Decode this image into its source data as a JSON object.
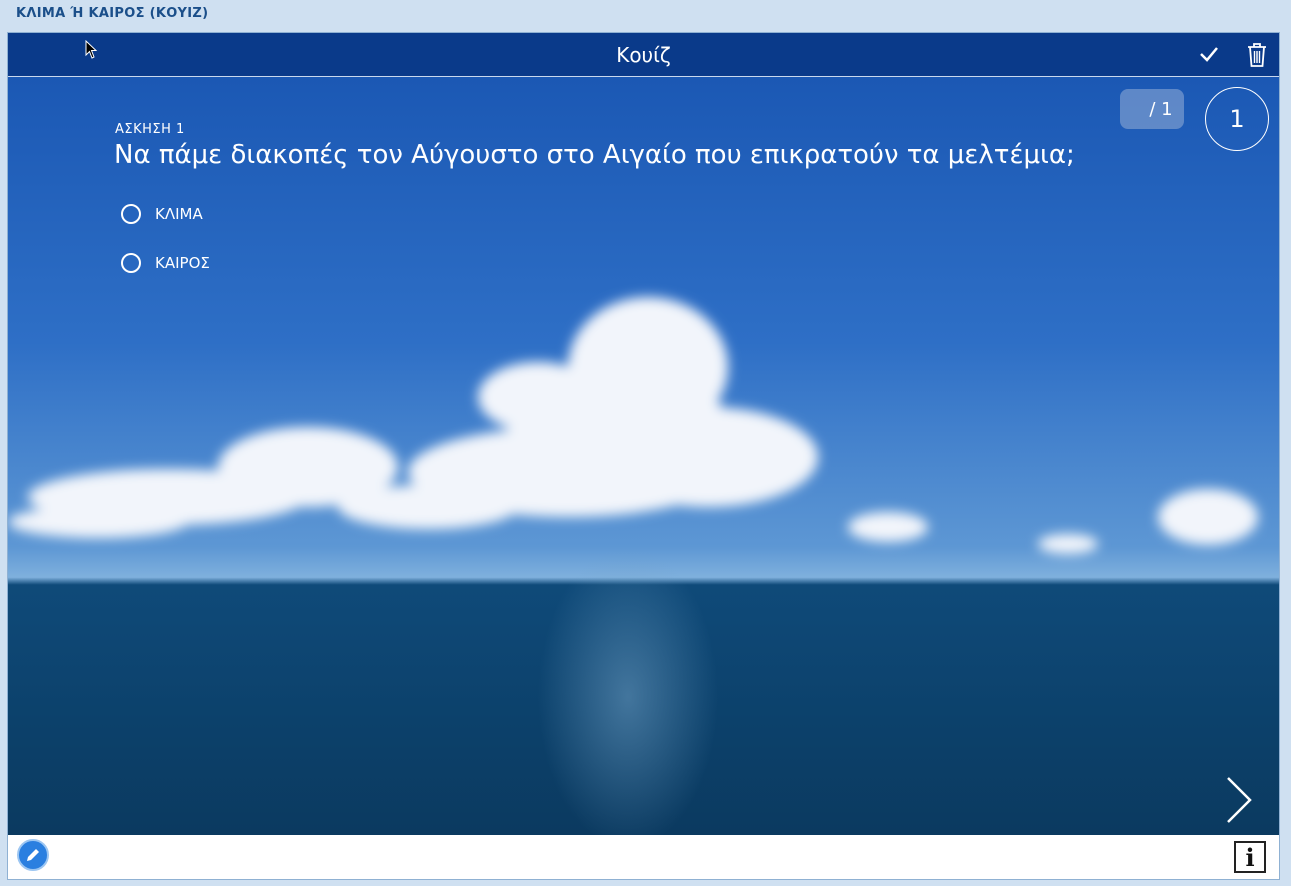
{
  "window": {
    "title": "ΚΛΙΜΑ Ή ΚΑΙΡΟΣ (ΚΟΥΙΖ)"
  },
  "header": {
    "title": "Κουίζ",
    "icons": [
      "check-icon",
      "trash-icon"
    ]
  },
  "question": {
    "label": "ΑΣΚΗΣΗ 1",
    "text": "Να πάμε διακοπές τον Αύγουστο στο Αιγαίο που επικρατούν τα μελτέμια;",
    "options": [
      "ΚΛΙΜΑ",
      "ΚΑΙΡΟΣ"
    ]
  },
  "counter": {
    "text": "/ 1"
  },
  "timer": {
    "value": "1"
  },
  "footer": {
    "icons": [
      "pencil-icon",
      "info-icon",
      "chevron-right-icon"
    ]
  },
  "colors": {
    "header": "#0a3a8a",
    "accent": "#2a7fe0",
    "window_bg": "#cfe0f1"
  }
}
